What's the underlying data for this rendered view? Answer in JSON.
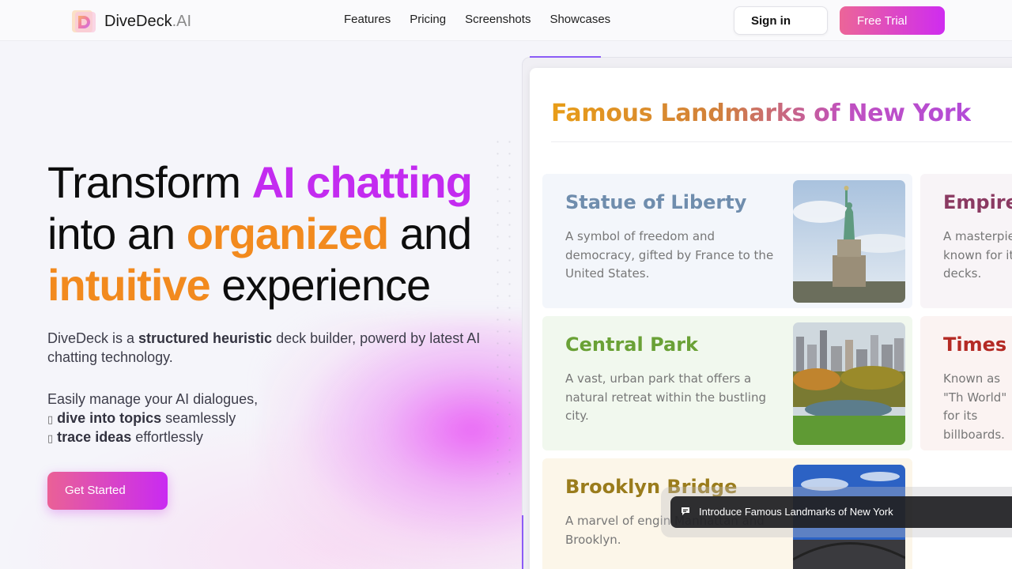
{
  "header": {
    "brand": "DiveDeck",
    "brand_suffix": ".AI",
    "nav": [
      "Features",
      "Pricing",
      "Screenshots",
      "Showcases"
    ],
    "signin_label": "Sign in",
    "trial_label": "Free Trial"
  },
  "hero": {
    "title_1a": "Transform ",
    "title_1b": "AI chatting",
    "title_2a": "into an ",
    "title_2b": "organized",
    "title_2c": " and",
    "title_3a": "intuitive",
    "title_3b": " experience",
    "desc_1": "DiveDeck is a ",
    "desc_bold": "structured heuristic",
    "desc_2": " deck builder, powerd by latest AI chatting technology.",
    "manage_line": "Easily manage your AI dialogues,",
    "feature_1_bold": "dive into topics",
    "feature_1_rest": " seamlessly",
    "feature_2_bold": "trace ideas",
    "feature_2_rest": " effortlessly",
    "get_started_label": "Get Started"
  },
  "slide": {
    "title": "Famous Landmarks of New York",
    "cards": [
      {
        "title": "Statue of Liberty",
        "desc": "A symbol of freedom and democracy, gifted by France to the United States.",
        "color": "#6f8dad"
      },
      {
        "title": "Empire S",
        "desc": "A masterpiec known for its decks.",
        "color": "#8b3a62"
      },
      {
        "title": "Central Park",
        "desc": "A vast, urban park that offers a natural retreat within the bustling city.",
        "color": "#6aa136"
      },
      {
        "title": "Times S",
        "desc": "Known as \"Th World\" for its billboards.",
        "color": "#b42a24"
      },
      {
        "title": "Brooklyn Bridge",
        "desc": "A marvel of engin Manhattan and Brooklyn.",
        "color": "#9a7c1c"
      }
    ]
  },
  "prompt": {
    "text": "Introduce Famous Landmarks of New York"
  },
  "colors": {
    "accent_purple": "#c32bf0",
    "accent_orange": "#f28a1e",
    "button_gradient_start": "#ec6598",
    "button_gradient_end": "#cf2cf0"
  }
}
